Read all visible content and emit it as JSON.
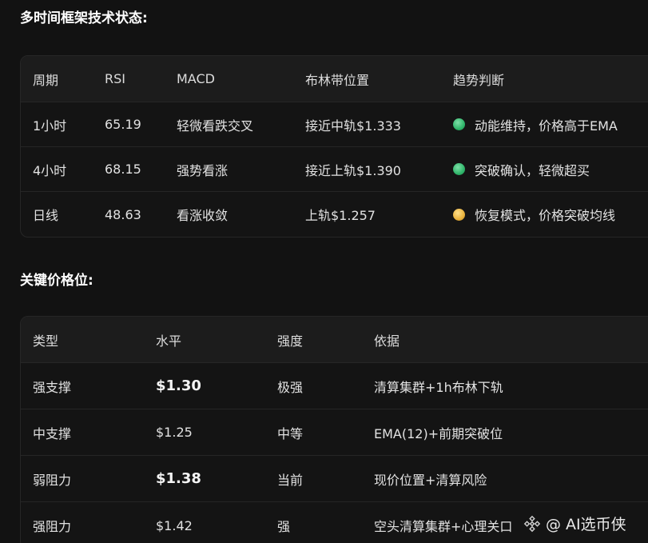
{
  "section1": {
    "title": "多时间框架技术状态:",
    "headers": [
      "周期",
      "RSI",
      "MACD",
      "布林带位置",
      "趋势判断"
    ],
    "rows": [
      {
        "period": "1小时",
        "rsi": "65.19",
        "macd": "轻微看跌交叉",
        "boll": "接近中轨$1.333",
        "trend": "动能维持，价格高于EMA",
        "status": "green"
      },
      {
        "period": "4小时",
        "rsi": "68.15",
        "macd": "强势看涨",
        "boll": "接近上轨$1.390",
        "trend": "突破确认，轻微超买",
        "status": "green"
      },
      {
        "period": "日线",
        "rsi": "48.63",
        "macd": "看涨收敛",
        "boll": "上轨$1.257",
        "trend": "恢复模式，价格突破均线",
        "status": "yellow"
      }
    ]
  },
  "section2": {
    "title": "关键价格位:",
    "headers": [
      "类型",
      "水平",
      "强度",
      "依据"
    ],
    "rows": [
      {
        "type": "强支撑",
        "level": "$1.30",
        "strength": "极强",
        "basis": "清算集群+1h布林下轨",
        "bold": true
      },
      {
        "type": "中支撑",
        "level": "$1.25",
        "strength": "中等",
        "basis": "EMA(12)+前期突破位",
        "bold": false
      },
      {
        "type": "弱阻力",
        "level": "$1.38",
        "strength": "当前",
        "basis": "现价位置+清算风险",
        "bold": true
      },
      {
        "type": "强阻力",
        "level": "$1.42",
        "strength": "强",
        "basis": "空头清算集群+心理关口",
        "bold": false
      }
    ]
  },
  "watermark": {
    "text": "@ AI选币侠",
    "icon": "binance-square-icon"
  },
  "colors": {
    "background": "#121212",
    "green": "#2fb56a",
    "yellow": "#e9b23c"
  }
}
